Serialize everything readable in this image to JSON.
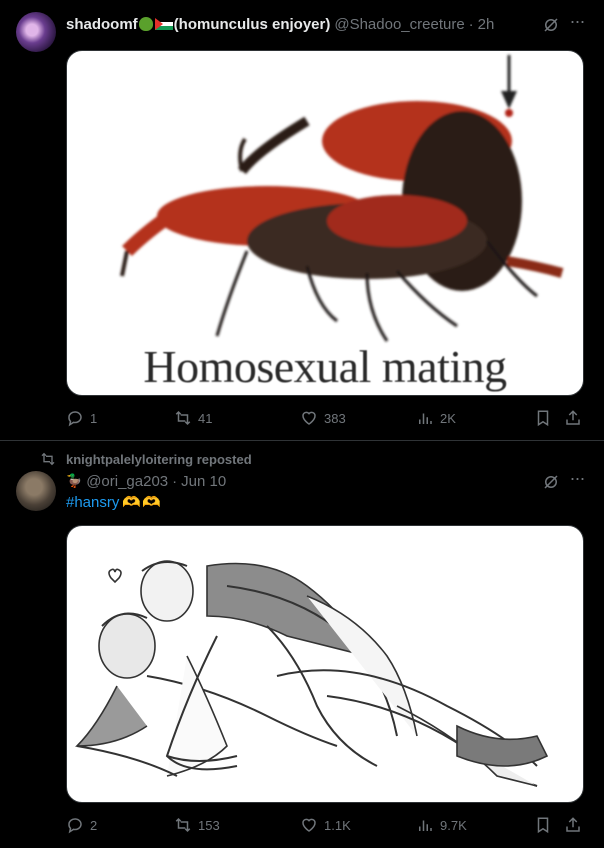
{
  "posts": [
    {
      "author_name": "shadoomf",
      "author_name_suffix": "(homunculus enjoyer)",
      "handle": "@Shadoo_creeture",
      "separator": "·",
      "time": "2h",
      "image_caption": "Homosexual mating",
      "stats": {
        "replies": "1",
        "reposts": "41",
        "likes": "383",
        "views": "2K"
      }
    },
    {
      "repost_label": "knightpalelyloitering reposted",
      "handle": "@ori_ga203",
      "separator": "·",
      "time": "Jun 10",
      "hashtag": "#hansry",
      "hearts": "🫶🫶",
      "stats": {
        "replies": "2",
        "reposts": "153",
        "likes": "1.1K",
        "views": "9.7K"
      }
    }
  ],
  "icons": {
    "grok": "grok-icon",
    "more": "more-icon",
    "reply": "reply-icon",
    "repost": "repost-icon",
    "like": "heart-icon",
    "views": "views-icon",
    "bookmark": "bookmark-icon",
    "share": "share-icon"
  },
  "colors": {
    "background": "#000000",
    "text": "#e7e9ea",
    "muted": "#71767b",
    "link": "#1d9bf0",
    "border": "#2f3336"
  }
}
